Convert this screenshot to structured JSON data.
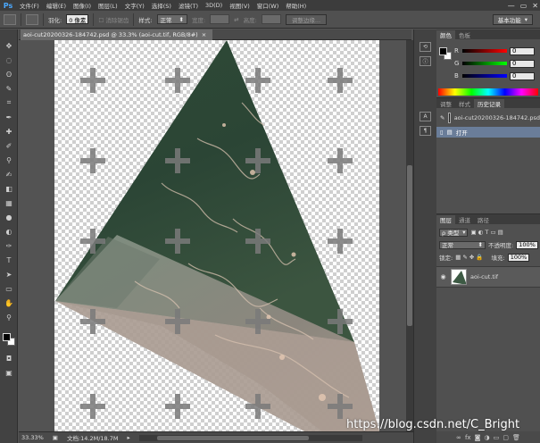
{
  "app": {
    "logo": "Ps"
  },
  "menu": [
    "文件(F)",
    "编辑(E)",
    "图像(I)",
    "图层(L)",
    "文字(Y)",
    "选择(S)",
    "滤镜(T)",
    "3D(D)",
    "视图(V)",
    "窗口(W)",
    "帮助(H)"
  ],
  "window_controls": {
    "minimize": "—",
    "restore": "▭",
    "close": "✕"
  },
  "options": {
    "feather_label": "羽化:",
    "feather_value": "0 像素",
    "antialias_label": "消除锯齿",
    "style_label": "样式:",
    "style_value": "正常",
    "width_label": "宽度:",
    "height_label": "高度:",
    "refine_button": "调整边缘...",
    "workspace_button": "基本功能"
  },
  "document": {
    "tab_title": "aoi-cut20200326-184742.psd @ 33.3% (aoi-cut.tif, RGB/8#)",
    "tab_close": "×"
  },
  "status": {
    "zoom": "33.33%",
    "doc_info": "文档:14.2M/18.7M"
  },
  "color_panel": {
    "tabs": [
      "颜色",
      "色板"
    ],
    "rows": [
      {
        "label": "R",
        "value": "0",
        "color": "#e03030"
      },
      {
        "label": "G",
        "value": "0",
        "color": "#30b030"
      },
      {
        "label": "B",
        "value": "0",
        "color": "#3050e0"
      }
    ]
  },
  "history_panel": {
    "tabs": [
      "调整",
      "样式",
      "历史记录"
    ],
    "items": [
      {
        "label": "aoi-cut20200326-184742.psd"
      },
      {
        "label": "打开"
      }
    ]
  },
  "layers_panel": {
    "tabs": [
      "图层",
      "通道",
      "路径"
    ],
    "kind_label": "ρ 类型",
    "blend_mode": "正常",
    "opacity_label": "不透明度:",
    "opacity_value": "100%",
    "lock_label": "锁定:",
    "fill_label": "填充:",
    "fill_value": "100%",
    "layer_name": "aoi-cut.tif",
    "footer_icons": [
      "link-icon",
      "fx-icon",
      "mask-icon",
      "adjustment-icon",
      "folder-icon",
      "new-layer-icon",
      "trash-icon"
    ]
  },
  "watermark": "https://blog.csdn.net/C_Bright"
}
